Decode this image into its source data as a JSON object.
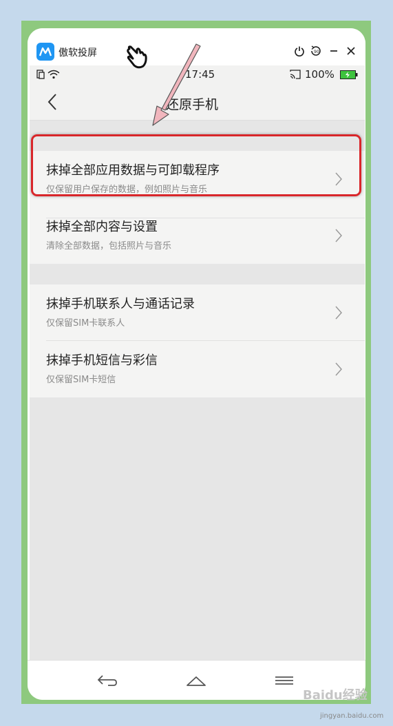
{
  "window": {
    "app_name": "傲软投屏",
    "controls": [
      "power-icon",
      "rotate-90-icon",
      "minimize-icon",
      "close-icon"
    ],
    "rotate_label": "90"
  },
  "statusbar": {
    "time": "17:45",
    "battery": "100%"
  },
  "header": {
    "title": "还原手机"
  },
  "groups": [
    [
      {
        "title": "抹掉全部应用数据与可卸载程序",
        "subtitle": "仅保留用户保存的数据，例如照片与音乐"
      },
      {
        "title": "抹掉全部内容与设置",
        "subtitle": "清除全部数据，包括照片与音乐"
      }
    ],
    [
      {
        "title": "抹掉手机联系人与通话记录",
        "subtitle": "仅保留SIM卡联系人"
      },
      {
        "title": "抹掉手机短信与彩信",
        "subtitle": "仅保留SIM卡短信"
      }
    ]
  ],
  "navbar": {
    "buttons": [
      "back-nav-icon",
      "home-nav-icon",
      "menu-nav-icon"
    ]
  },
  "watermark": {
    "brand": "Baidu经验",
    "url": "jingyan.baidu.com"
  },
  "colors": {
    "highlight": "#d9262a",
    "arrow": "#f1b6bd",
    "logo": "#1f96f3",
    "frame": "#8ec97e",
    "battery": "#3ec23e"
  }
}
